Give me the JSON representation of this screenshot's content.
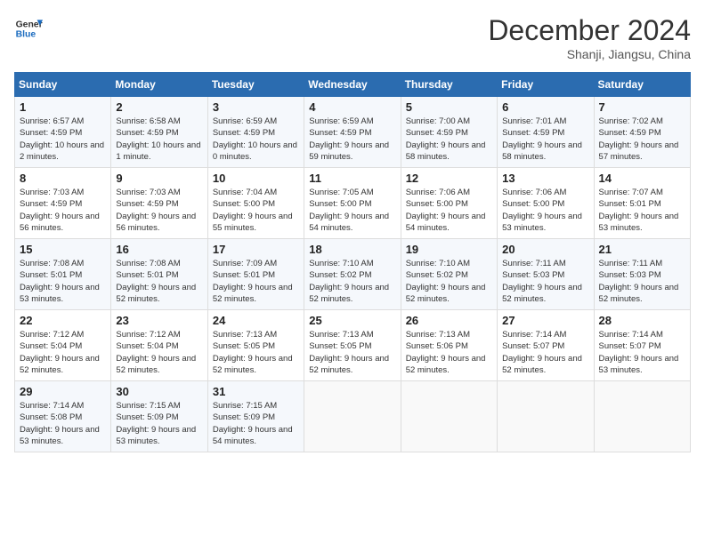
{
  "header": {
    "logo_line1": "General",
    "logo_line2": "Blue",
    "month": "December 2024",
    "location": "Shanji, Jiangsu, China"
  },
  "days_of_week": [
    "Sunday",
    "Monday",
    "Tuesday",
    "Wednesday",
    "Thursday",
    "Friday",
    "Saturday"
  ],
  "weeks": [
    [
      {
        "day": "1",
        "sunrise": "6:57 AM",
        "sunset": "4:59 PM",
        "daylight": "10 hours and 2 minutes."
      },
      {
        "day": "2",
        "sunrise": "6:58 AM",
        "sunset": "4:59 PM",
        "daylight": "10 hours and 1 minute."
      },
      {
        "day": "3",
        "sunrise": "6:59 AM",
        "sunset": "4:59 PM",
        "daylight": "10 hours and 0 minutes."
      },
      {
        "day": "4",
        "sunrise": "6:59 AM",
        "sunset": "4:59 PM",
        "daylight": "9 hours and 59 minutes."
      },
      {
        "day": "5",
        "sunrise": "7:00 AM",
        "sunset": "4:59 PM",
        "daylight": "9 hours and 58 minutes."
      },
      {
        "day": "6",
        "sunrise": "7:01 AM",
        "sunset": "4:59 PM",
        "daylight": "9 hours and 58 minutes."
      },
      {
        "day": "7",
        "sunrise": "7:02 AM",
        "sunset": "4:59 PM",
        "daylight": "9 hours and 57 minutes."
      }
    ],
    [
      {
        "day": "8",
        "sunrise": "7:03 AM",
        "sunset": "4:59 PM",
        "daylight": "9 hours and 56 minutes."
      },
      {
        "day": "9",
        "sunrise": "7:03 AM",
        "sunset": "4:59 PM",
        "daylight": "9 hours and 56 minutes."
      },
      {
        "day": "10",
        "sunrise": "7:04 AM",
        "sunset": "5:00 PM",
        "daylight": "9 hours and 55 minutes."
      },
      {
        "day": "11",
        "sunrise": "7:05 AM",
        "sunset": "5:00 PM",
        "daylight": "9 hours and 54 minutes."
      },
      {
        "day": "12",
        "sunrise": "7:06 AM",
        "sunset": "5:00 PM",
        "daylight": "9 hours and 54 minutes."
      },
      {
        "day": "13",
        "sunrise": "7:06 AM",
        "sunset": "5:00 PM",
        "daylight": "9 hours and 53 minutes."
      },
      {
        "day": "14",
        "sunrise": "7:07 AM",
        "sunset": "5:01 PM",
        "daylight": "9 hours and 53 minutes."
      }
    ],
    [
      {
        "day": "15",
        "sunrise": "7:08 AM",
        "sunset": "5:01 PM",
        "daylight": "9 hours and 53 minutes."
      },
      {
        "day": "16",
        "sunrise": "7:08 AM",
        "sunset": "5:01 PM",
        "daylight": "9 hours and 52 minutes."
      },
      {
        "day": "17",
        "sunrise": "7:09 AM",
        "sunset": "5:01 PM",
        "daylight": "9 hours and 52 minutes."
      },
      {
        "day": "18",
        "sunrise": "7:10 AM",
        "sunset": "5:02 PM",
        "daylight": "9 hours and 52 minutes."
      },
      {
        "day": "19",
        "sunrise": "7:10 AM",
        "sunset": "5:02 PM",
        "daylight": "9 hours and 52 minutes."
      },
      {
        "day": "20",
        "sunrise": "7:11 AM",
        "sunset": "5:03 PM",
        "daylight": "9 hours and 52 minutes."
      },
      {
        "day": "21",
        "sunrise": "7:11 AM",
        "sunset": "5:03 PM",
        "daylight": "9 hours and 52 minutes."
      }
    ],
    [
      {
        "day": "22",
        "sunrise": "7:12 AM",
        "sunset": "5:04 PM",
        "daylight": "9 hours and 52 minutes."
      },
      {
        "day": "23",
        "sunrise": "7:12 AM",
        "sunset": "5:04 PM",
        "daylight": "9 hours and 52 minutes."
      },
      {
        "day": "24",
        "sunrise": "7:13 AM",
        "sunset": "5:05 PM",
        "daylight": "9 hours and 52 minutes."
      },
      {
        "day": "25",
        "sunrise": "7:13 AM",
        "sunset": "5:05 PM",
        "daylight": "9 hours and 52 minutes."
      },
      {
        "day": "26",
        "sunrise": "7:13 AM",
        "sunset": "5:06 PM",
        "daylight": "9 hours and 52 minutes."
      },
      {
        "day": "27",
        "sunrise": "7:14 AM",
        "sunset": "5:07 PM",
        "daylight": "9 hours and 52 minutes."
      },
      {
        "day": "28",
        "sunrise": "7:14 AM",
        "sunset": "5:07 PM",
        "daylight": "9 hours and 53 minutes."
      }
    ],
    [
      {
        "day": "29",
        "sunrise": "7:14 AM",
        "sunset": "5:08 PM",
        "daylight": "9 hours and 53 minutes."
      },
      {
        "day": "30",
        "sunrise": "7:15 AM",
        "sunset": "5:09 PM",
        "daylight": "9 hours and 53 minutes."
      },
      {
        "day": "31",
        "sunrise": "7:15 AM",
        "sunset": "5:09 PM",
        "daylight": "9 hours and 54 minutes."
      },
      null,
      null,
      null,
      null
    ]
  ]
}
